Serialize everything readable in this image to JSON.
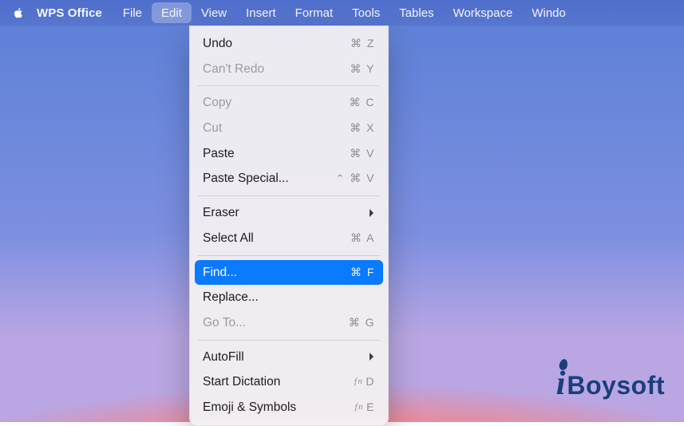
{
  "menubar": {
    "app_name": "WPS Office",
    "menus": [
      {
        "label": "File"
      },
      {
        "label": "Edit",
        "active": true
      },
      {
        "label": "View"
      },
      {
        "label": "Insert"
      },
      {
        "label": "Format"
      },
      {
        "label": "Tools"
      },
      {
        "label": "Tables"
      },
      {
        "label": "Workspace"
      },
      {
        "label": "Windo"
      }
    ]
  },
  "edit_menu": {
    "groups": [
      [
        {
          "label": "Undo",
          "shortcut": "⌘ Z",
          "enabled": true
        },
        {
          "label": "Can't Redo",
          "shortcut": "⌘ Y",
          "enabled": false
        }
      ],
      [
        {
          "label": "Copy",
          "shortcut": "⌘ C",
          "enabled": false
        },
        {
          "label": "Cut",
          "shortcut": "⌘ X",
          "enabled": false
        },
        {
          "label": "Paste",
          "shortcut": "⌘ V",
          "enabled": true
        },
        {
          "label": "Paste Special...",
          "shortcut": "^ ⌘ V",
          "enabled": true,
          "has_ctrl": true
        }
      ],
      [
        {
          "label": "Eraser",
          "submenu": true,
          "enabled": true
        },
        {
          "label": "Select All",
          "shortcut": "⌘ A",
          "enabled": true
        }
      ],
      [
        {
          "label": "Find...",
          "shortcut": "⌘ F",
          "enabled": true,
          "highlight": true
        },
        {
          "label": "Replace...",
          "enabled": true
        },
        {
          "label": "Go To...",
          "shortcut": "⌘ G",
          "enabled": false
        }
      ],
      [
        {
          "label": "AutoFill",
          "submenu": true,
          "enabled": true
        },
        {
          "label": "Start Dictation",
          "fn_key": "D",
          "enabled": true
        },
        {
          "label": "Emoji & Symbols",
          "fn_key": "E",
          "enabled": true
        }
      ]
    ]
  },
  "watermark": {
    "i": "i",
    "rest": "Boysoft"
  }
}
